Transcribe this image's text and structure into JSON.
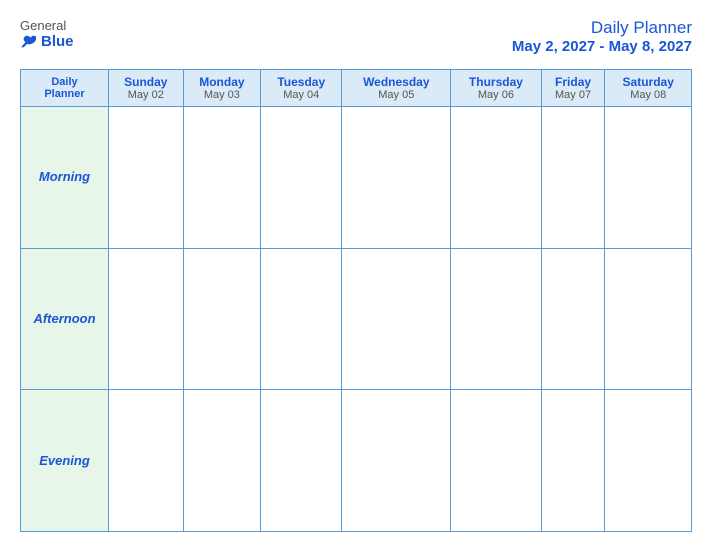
{
  "logo": {
    "general": "General",
    "blue": "Blue",
    "bird_icon": "bird"
  },
  "header": {
    "title": "Daily Planner",
    "date_range": "May 2, 2027 - May 8, 2027"
  },
  "columns": [
    {
      "id": "daily-planner",
      "day": "Daily",
      "day2": "Planner",
      "date": ""
    },
    {
      "id": "sunday",
      "day": "Sunday",
      "date": "May 02"
    },
    {
      "id": "monday",
      "day": "Monday",
      "date": "May 03"
    },
    {
      "id": "tuesday",
      "day": "Tuesday",
      "date": "May 04"
    },
    {
      "id": "wednesday",
      "day": "Wednesday",
      "date": "May 05"
    },
    {
      "id": "thursday",
      "day": "Thursday",
      "date": "May 06"
    },
    {
      "id": "friday",
      "day": "Friday",
      "date": "May 07"
    },
    {
      "id": "saturday",
      "day": "Saturday",
      "date": "May 08"
    }
  ],
  "rows": [
    {
      "id": "morning",
      "label": "Morning"
    },
    {
      "id": "afternoon",
      "label": "Afternoon"
    },
    {
      "id": "evening",
      "label": "Evening"
    }
  ],
  "colors": {
    "border": "#5b9bd5",
    "header_bg": "#dbeaf7",
    "row_label_bg": "#e8f5e9",
    "cell_bg": "#ffffff",
    "text_blue": "#1a56d6",
    "text_dark": "#555555"
  }
}
